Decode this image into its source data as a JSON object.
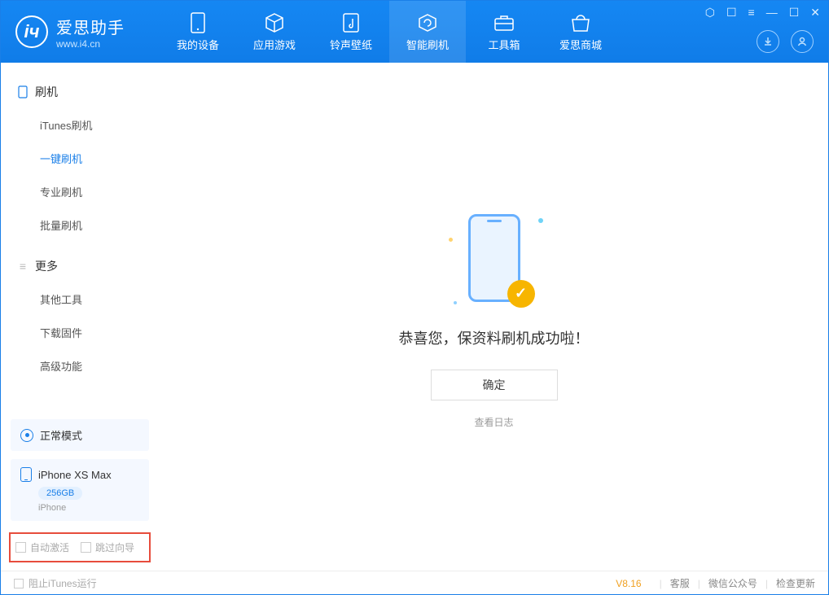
{
  "app": {
    "title": "爱思助手",
    "subtitle": "www.i4.cn"
  },
  "window_controls": {
    "t1": "⬡",
    "t2": "☐",
    "t3": "≡",
    "min": "—",
    "max": "☐",
    "close": "✕"
  },
  "tabs": [
    {
      "label": "我的设备"
    },
    {
      "label": "应用游戏"
    },
    {
      "label": "铃声壁纸"
    },
    {
      "label": "智能刷机"
    },
    {
      "label": "工具箱"
    },
    {
      "label": "爱思商城"
    }
  ],
  "sidebar": {
    "section1": {
      "title": "刷机",
      "items": [
        "iTunes刷机",
        "一键刷机",
        "专业刷机",
        "批量刷机"
      ]
    },
    "section2": {
      "title": "更多",
      "items": [
        "其他工具",
        "下载固件",
        "高级功能"
      ]
    }
  },
  "device": {
    "mode": "正常模式",
    "name": "iPhone XS Max",
    "capacity": "256GB",
    "sub": "iPhone"
  },
  "options": {
    "auto_activate": "自动激活",
    "skip_guide": "跳过向导"
  },
  "main": {
    "message": "恭喜您，保资料刷机成功啦！",
    "ok": "确定",
    "log": "查看日志"
  },
  "status": {
    "block_itunes": "阻止iTunes运行",
    "version": "V8.16",
    "cs": "客服",
    "wechat": "微信公众号",
    "update": "检查更新"
  }
}
